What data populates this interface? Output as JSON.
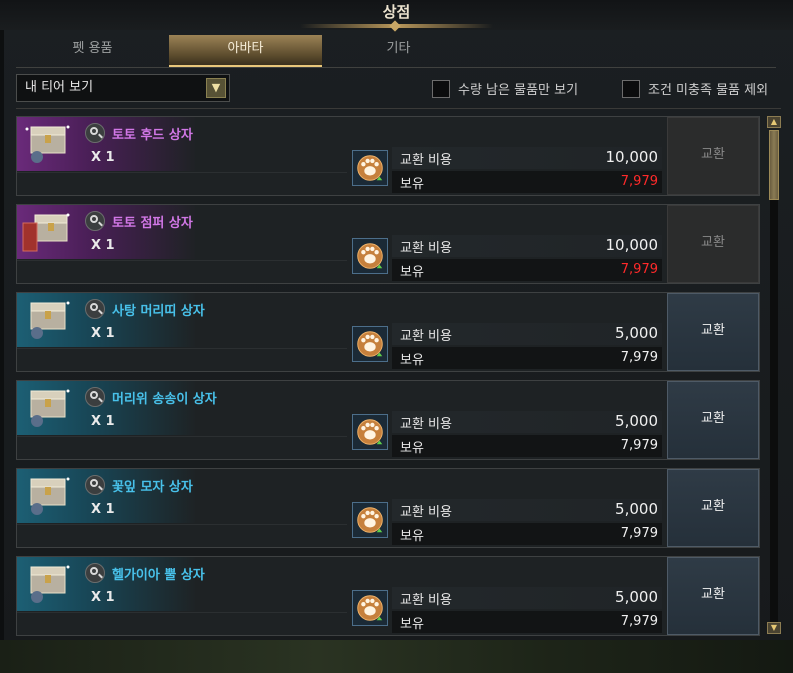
{
  "window": {
    "title": "상점"
  },
  "tabs": [
    {
      "label": "펫 용품",
      "active": false
    },
    {
      "label": "아바타",
      "active": true
    },
    {
      "label": "기타",
      "active": false
    }
  ],
  "filters": {
    "dropdown_value": "내 티어 보기",
    "check_remaining": "수량 남은 물품만 보기",
    "check_exclude": "조건 미충족 물품 제외"
  },
  "cost_labels": {
    "cost": "교환 비용",
    "owned": "보유"
  },
  "items": [
    {
      "name": "토토 후드 상자",
      "qty": "X 1",
      "cost": "10,000",
      "owned": "7,979",
      "owned_insufficient": true,
      "button": "교환",
      "button_enabled": false,
      "rarity": "purple"
    },
    {
      "name": "토토 점퍼 상자",
      "qty": "X 1",
      "cost": "10,000",
      "owned": "7,979",
      "owned_insufficient": true,
      "button": "교환",
      "button_enabled": false,
      "rarity": "purple"
    },
    {
      "name": "사탕 머리띠 상자",
      "qty": "X 1",
      "cost": "5,000",
      "owned": "7,979",
      "owned_insufficient": false,
      "button": "교환",
      "button_enabled": true,
      "rarity": "blue"
    },
    {
      "name": "머리위 송송이 상자",
      "qty": "X 1",
      "cost": "5,000",
      "owned": "7,979",
      "owned_insufficient": false,
      "button": "교환",
      "button_enabled": true,
      "rarity": "blue"
    },
    {
      "name": "꽃잎 모자 상자",
      "qty": "X 1",
      "cost": "5,000",
      "owned": "7,979",
      "owned_insufficient": false,
      "button": "교환",
      "button_enabled": true,
      "rarity": "blue"
    },
    {
      "name": "헬가이아 뿔 상자",
      "qty": "X 1",
      "cost": "5,000",
      "owned": "7,979",
      "owned_insufficient": false,
      "button": "교환",
      "button_enabled": true,
      "rarity": "blue"
    }
  ],
  "colors": {
    "purple_name": "#d177e6",
    "blue_name": "#48c1ea",
    "insufficient": "#ff2a2a",
    "accent_gold": "#e9c77b"
  },
  "icons": {
    "search": "magnifier-icon",
    "currency": "paw-currency-icon",
    "item": "chest-icon"
  }
}
